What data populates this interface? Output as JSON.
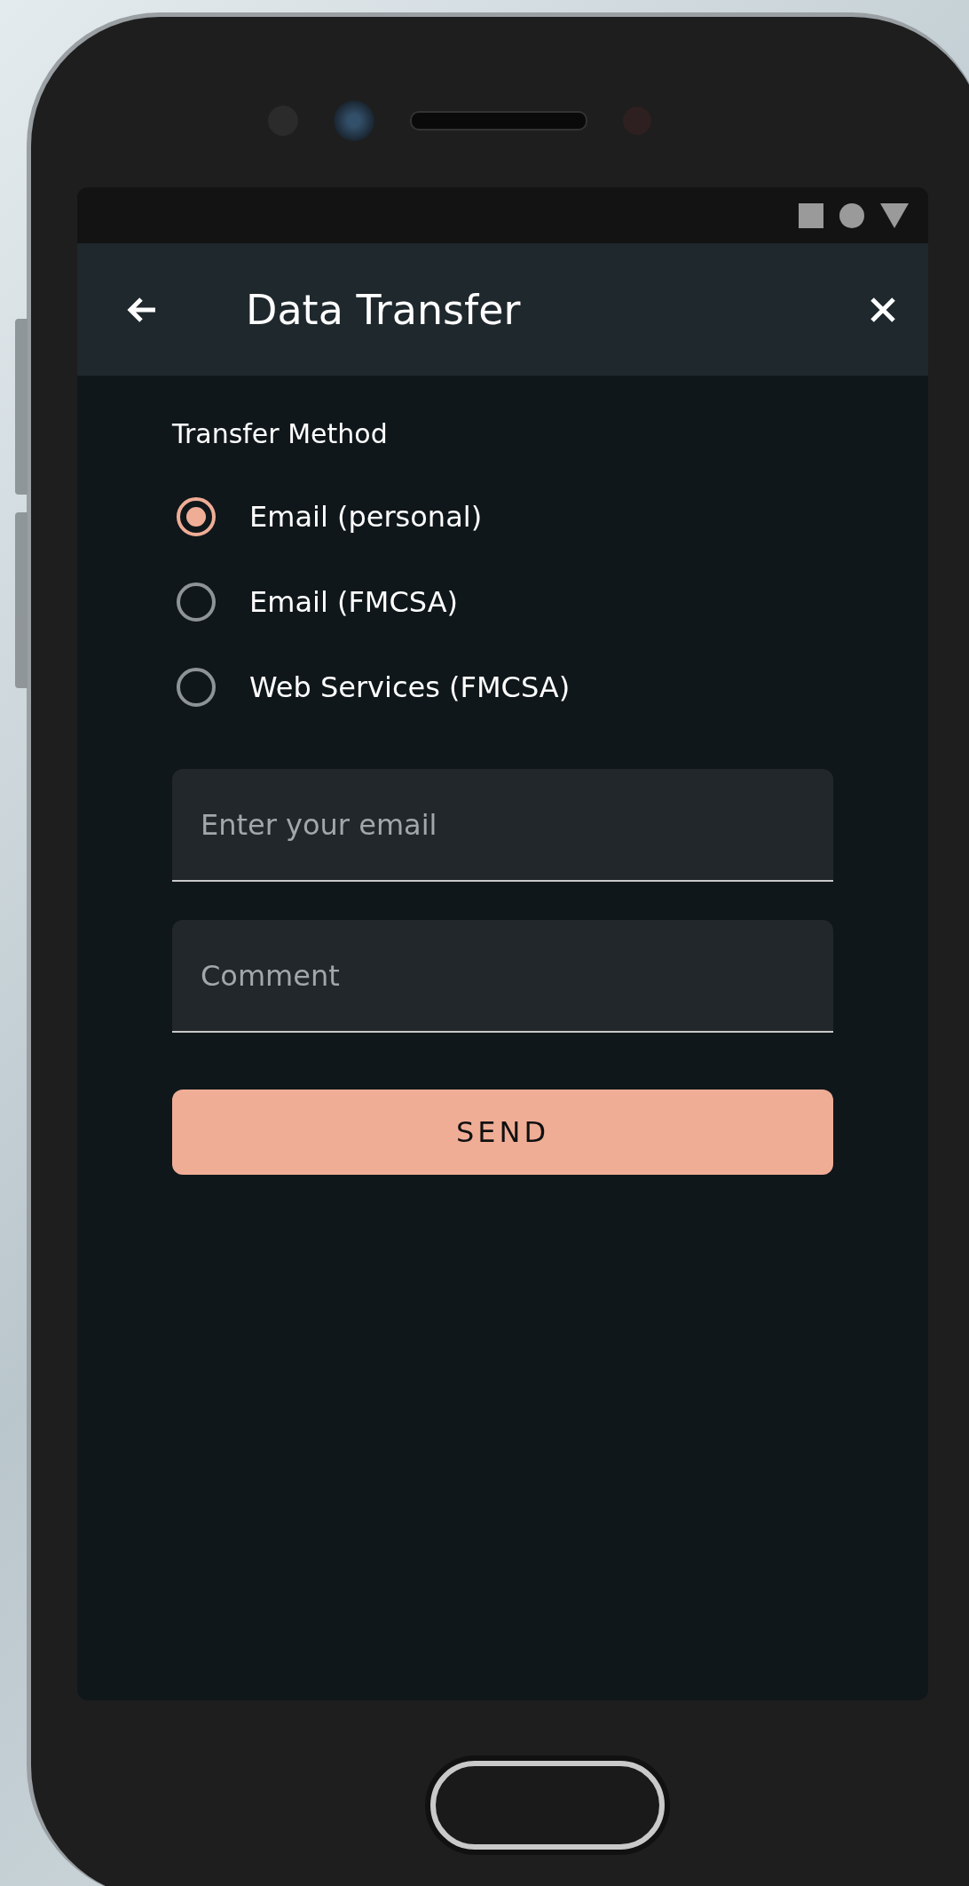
{
  "app_bar": {
    "title": "Data Transfer"
  },
  "transfer_method": {
    "label": "Transfer Method",
    "options": [
      {
        "label": "Email (personal)",
        "selected": true
      },
      {
        "label": "Email (FMCSA)",
        "selected": false
      },
      {
        "label": "Web Services (FMCSA)",
        "selected": false
      }
    ]
  },
  "fields": [
    {
      "placeholder": "Enter your email"
    },
    {
      "placeholder": "Comment"
    }
  ],
  "send_button": {
    "label": "SEND"
  }
}
